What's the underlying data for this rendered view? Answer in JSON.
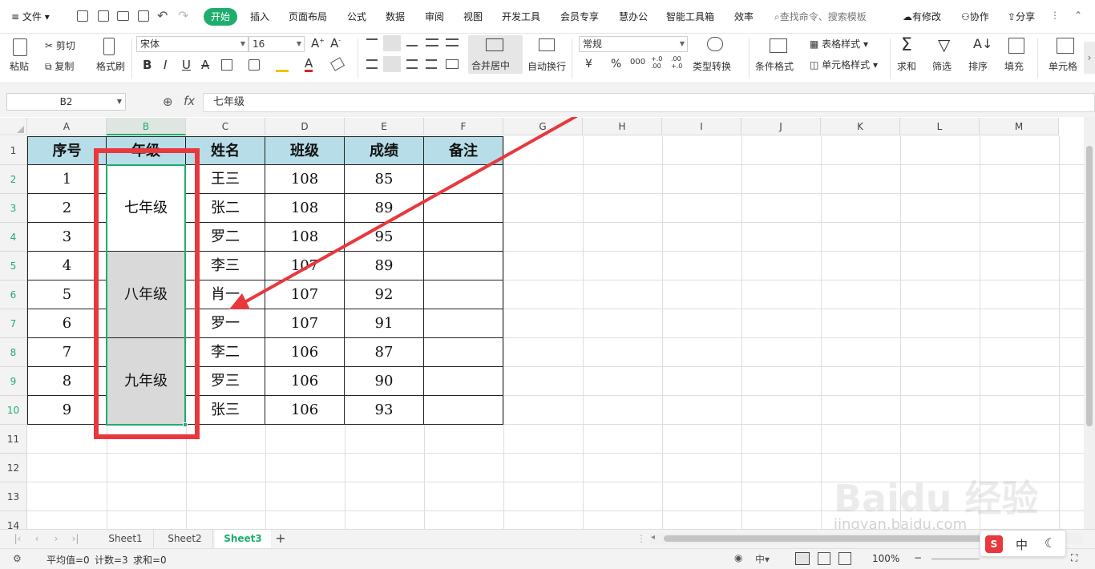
{
  "menu": {
    "file": "文件",
    "tabs": [
      "开始",
      "插入",
      "页面布局",
      "公式",
      "数据",
      "审阅",
      "视图",
      "开发工具",
      "会员专享",
      "慧办公",
      "智能工具箱",
      "效率"
    ],
    "search_placeholder": "查找命令、搜索模板",
    "right": [
      "有修改",
      "协作",
      "分享"
    ]
  },
  "toolbar": {
    "paste": "粘贴",
    "cut": "剪切",
    "copy": "复制",
    "format_painter": "格式刷",
    "font_name": "宋体",
    "font_size": "16",
    "bold": "B",
    "italic": "I",
    "underline": "U",
    "merge_center": "合并居中",
    "auto_wrap": "自动换行",
    "number_format": "常规",
    "type_convert": "类型转换",
    "cond_format": "条件格式",
    "table_style": "表格样式",
    "cell_style": "单元格样式",
    "sum": "求和",
    "filter": "筛选",
    "sort": "排序",
    "fill": "填充",
    "cell": "单元格",
    "currency": "¥",
    "percent": "%",
    "thousands": "000",
    "inc_decimal": "+.0 .00",
    "dec_decimal": ".00 +.0"
  },
  "formula_bar": {
    "name_box": "B2",
    "fx": "fx",
    "content": "七年级"
  },
  "columns": [
    "A",
    "B",
    "C",
    "D",
    "E",
    "F",
    "G",
    "H",
    "I",
    "J",
    "K",
    "L",
    "M"
  ],
  "rows": [
    "1",
    "2",
    "3",
    "4",
    "5",
    "6",
    "7",
    "8",
    "9",
    "10",
    "11",
    "12",
    "13",
    "14"
  ],
  "table": {
    "headers": [
      "序号",
      "年级",
      "姓名",
      "班级",
      "成绩",
      "备注"
    ],
    "rows": [
      {
        "no": "1",
        "name": "王三",
        "cls": "108",
        "score": "85",
        "note": ""
      },
      {
        "no": "2",
        "name": "张二",
        "cls": "108",
        "score": "89",
        "note": ""
      },
      {
        "no": "3",
        "name": "罗二",
        "cls": "108",
        "score": "95",
        "note": ""
      },
      {
        "no": "4",
        "name": "李三",
        "cls": "107",
        "score": "89",
        "note": ""
      },
      {
        "no": "5",
        "name": "肖一",
        "cls": "107",
        "score": "92",
        "note": ""
      },
      {
        "no": "6",
        "name": "罗一",
        "cls": "107",
        "score": "91",
        "note": ""
      },
      {
        "no": "7",
        "name": "李二",
        "cls": "106",
        "score": "87",
        "note": ""
      },
      {
        "no": "8",
        "name": "罗三",
        "cls": "106",
        "score": "90",
        "note": ""
      },
      {
        "no": "9",
        "name": "张三",
        "cls": "106",
        "score": "93",
        "note": ""
      }
    ],
    "grades": [
      "七年级",
      "八年级",
      "九年级"
    ]
  },
  "sheets": [
    "Sheet1",
    "Sheet2",
    "Sheet3"
  ],
  "active_sheet": "Sheet3",
  "status": {
    "avg": "平均值=0",
    "count": "计数=3",
    "sum": "求和=0",
    "zoom": "100%"
  },
  "watermark": "jingyan.baidu.com",
  "colors": {
    "accent": "#1fad6e",
    "header_fill": "#b7dde8",
    "merged_fill": "#d9d9d9",
    "annotation": "#e8383d"
  }
}
